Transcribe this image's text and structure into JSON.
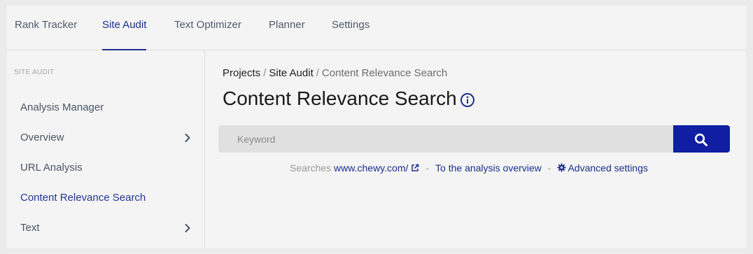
{
  "topnav": {
    "tabs": [
      {
        "label": "Rank Tracker"
      },
      {
        "label": "Site Audit"
      },
      {
        "label": "Text Optimizer"
      },
      {
        "label": "Planner"
      },
      {
        "label": "Settings"
      }
    ],
    "active_tab": "Site Audit"
  },
  "sidebar": {
    "heading": "SITE AUDIT",
    "items": [
      {
        "label": "Analysis Manager",
        "has_chevron": false
      },
      {
        "label": "Overview",
        "has_chevron": true
      },
      {
        "label": "URL Analysis",
        "has_chevron": false
      },
      {
        "label": "Content Relevance Search",
        "has_chevron": false
      },
      {
        "label": "Text",
        "has_chevron": true
      }
    ],
    "active_item": "Content Relevance Search"
  },
  "main": {
    "breadcrumb": {
      "items": [
        "Projects",
        "Site Audit",
        "Content Relevance Search"
      ],
      "separator": "/"
    },
    "title": "Content Relevance Search",
    "search": {
      "placeholder": "Keyword",
      "value": ""
    },
    "meta": {
      "searches_prefix": "Searches",
      "site_link": "www.chewy.com/",
      "separator": "-",
      "overview_link": "To the analysis overview",
      "advanced_settings": "Advanced settings"
    }
  },
  "icons": {
    "info": "info-circle-icon",
    "search": "magnifier-icon",
    "external": "external-link-icon",
    "gear": "gear-icon",
    "chevron": "chevron-right-icon"
  },
  "colors": {
    "accent": "#1b2f8c",
    "search_button": "#0f1ea3",
    "active_sidebar": "#23349a"
  }
}
